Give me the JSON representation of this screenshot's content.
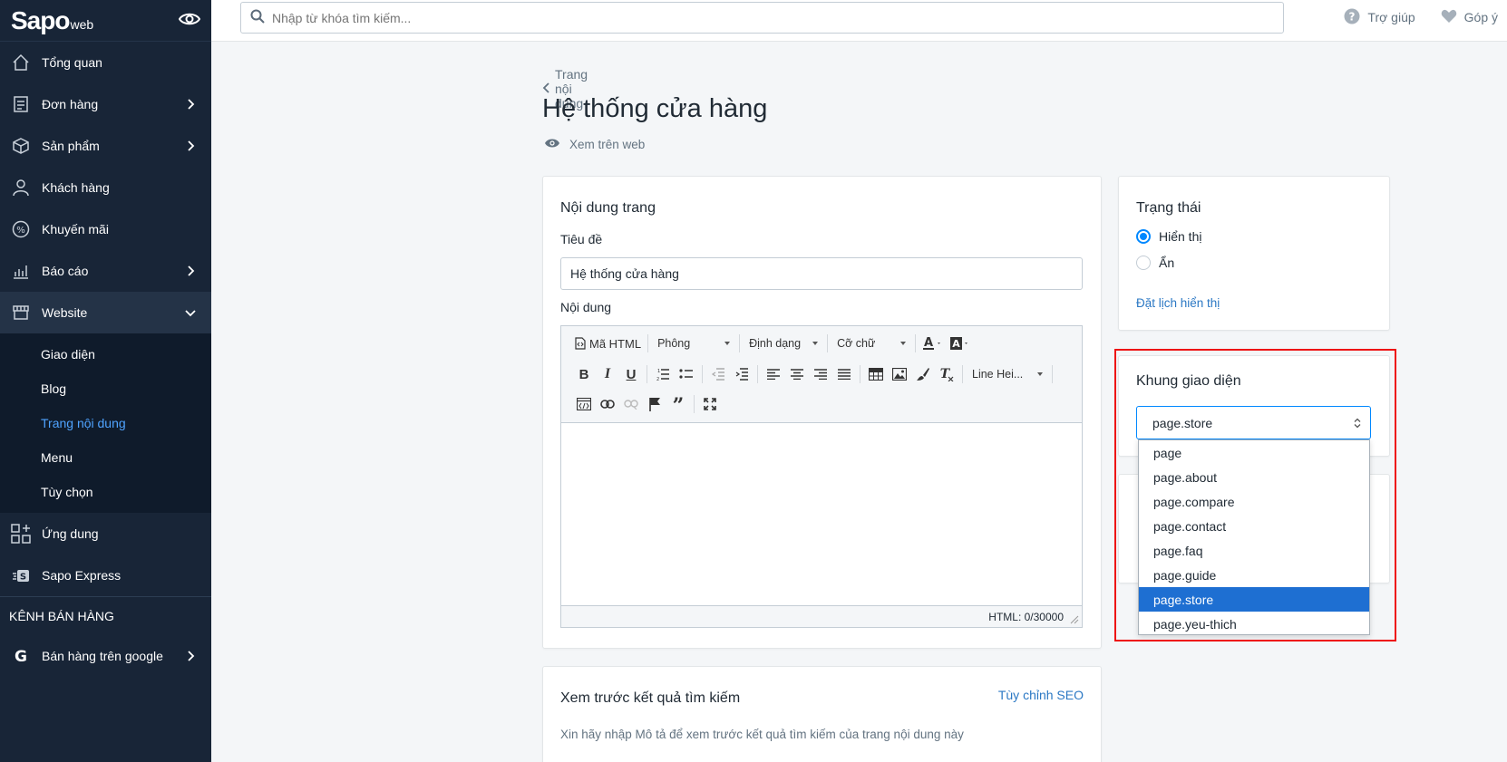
{
  "sidebar": {
    "logo": {
      "brand": "Sapo",
      "suffix": "web"
    },
    "items": [
      {
        "label": "Tổng quan",
        "icon": "home-icon"
      },
      {
        "label": "Đơn hàng",
        "icon": "orders-icon"
      },
      {
        "label": "Sản phẩm",
        "icon": "box-icon"
      },
      {
        "label": "Khách hàng",
        "icon": "user-icon"
      },
      {
        "label": "Khuyến mãi",
        "icon": "percent-icon"
      },
      {
        "label": "Báo cáo",
        "icon": "chart-icon"
      },
      {
        "label": "Website",
        "icon": "store-icon"
      }
    ],
    "website_sub": [
      "Giao diện",
      "Blog",
      "Trang nội dung",
      "Menu",
      "Tùy chọn"
    ],
    "apps_label": "Ứng dung",
    "express_label": "Sapo Express",
    "channel_section": "KÊNH BÁN HÀNG",
    "google_label": "Bán hàng trên google"
  },
  "topbar": {
    "search_placeholder": "Nhập từ khóa tìm kiếm...",
    "help_label": "Trợ giúp",
    "feedback_label": "Góp ý"
  },
  "page": {
    "back_label": "Trang nội dung",
    "title": "Hệ thống cửa hàng",
    "view_on_web": "Xem trên web"
  },
  "content_card": {
    "title": "Nội dung trang",
    "title_label": "Tiêu đề",
    "title_value": "Hệ thống cửa hàng",
    "content_label": "Nội dung",
    "toolbar": {
      "html_btn": "Mã HTML",
      "font_drop": "Phông",
      "format_drop": "Định dạng",
      "size_drop": "Cỡ chữ",
      "line_height_drop": "Line Hei..."
    },
    "char_count": "HTML: 0/30000"
  },
  "seo_card": {
    "title": "Xem trước kết quả tìm kiếm",
    "customize_link": "Tùy chỉnh SEO",
    "description": "Xin hãy nhập Mô tả để xem trước kết quả tìm kiếm của trang nội dung này"
  },
  "status_card": {
    "title": "Trạng thái",
    "option_visible": "Hiển thị",
    "option_hidden": "Ẩn",
    "schedule_link": "Đặt lịch hiển thị"
  },
  "theme_card": {
    "title": "Khung giao diện",
    "selected": "page.store",
    "options": [
      "page",
      "page.about",
      "page.compare",
      "page.contact",
      "page.faq",
      "page.guide",
      "page.store",
      "page.yeu-thich"
    ],
    "selected_index": 6
  },
  "colors": {
    "sidebar_bg": "#182537",
    "accent": "#0088ff",
    "link": "#2b78c4",
    "highlight": "#e11111"
  }
}
